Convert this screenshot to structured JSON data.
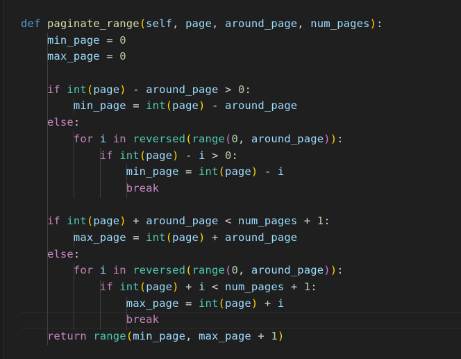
{
  "editor": {
    "theme": {
      "background": "#1f1f1f",
      "keyword": "#569cd6",
      "control": "#c586c0",
      "function": "#dcdcaa",
      "class": "#4ec9b0",
      "variable": "#9cdcfe",
      "number": "#b5cea8",
      "operator": "#d4d4d4",
      "bracket1": "#ffd700",
      "bracket2": "#da70d6",
      "bracket3": "#179fff"
    },
    "lines": [
      [
        [
          "kw",
          "def"
        ],
        [
          "op",
          " "
        ],
        [
          "fn",
          "paginate_range"
        ],
        [
          "b1",
          "("
        ],
        [
          "var",
          "self"
        ],
        [
          "op",
          ", "
        ],
        [
          "var",
          "page"
        ],
        [
          "op",
          ", "
        ],
        [
          "var",
          "around_page"
        ],
        [
          "op",
          ", "
        ],
        [
          "var",
          "num_pages"
        ],
        [
          "b1",
          ")"
        ],
        [
          "op",
          ":"
        ]
      ],
      [
        [
          "op",
          "    "
        ],
        [
          "var",
          "min_page"
        ],
        [
          "op",
          " = "
        ],
        [
          "num",
          "0"
        ]
      ],
      [
        [
          "op",
          "    "
        ],
        [
          "var",
          "max_page"
        ],
        [
          "op",
          " = "
        ],
        [
          "num",
          "0"
        ]
      ],
      [],
      [
        [
          "op",
          "    "
        ],
        [
          "ctrl",
          "if"
        ],
        [
          "op",
          " "
        ],
        [
          "cls",
          "int"
        ],
        [
          "b1",
          "("
        ],
        [
          "var",
          "page"
        ],
        [
          "b1",
          ")"
        ],
        [
          "op",
          " - "
        ],
        [
          "var",
          "around_page"
        ],
        [
          "op",
          " > "
        ],
        [
          "num",
          "0"
        ],
        [
          "op",
          ":"
        ]
      ],
      [
        [
          "op",
          "        "
        ],
        [
          "var",
          "min_page"
        ],
        [
          "op",
          " = "
        ],
        [
          "cls",
          "int"
        ],
        [
          "b1",
          "("
        ],
        [
          "var",
          "page"
        ],
        [
          "b1",
          ")"
        ],
        [
          "op",
          " - "
        ],
        [
          "var",
          "around_page"
        ]
      ],
      [
        [
          "op",
          "    "
        ],
        [
          "ctrl",
          "else"
        ],
        [
          "op",
          ":"
        ]
      ],
      [
        [
          "op",
          "        "
        ],
        [
          "ctrl",
          "for"
        ],
        [
          "op",
          " "
        ],
        [
          "var",
          "i"
        ],
        [
          "op",
          " "
        ],
        [
          "ctrl",
          "in"
        ],
        [
          "op",
          " "
        ],
        [
          "cls",
          "reversed"
        ],
        [
          "b1",
          "("
        ],
        [
          "cls",
          "range"
        ],
        [
          "b2",
          "("
        ],
        [
          "num",
          "0"
        ],
        [
          "op",
          ", "
        ],
        [
          "var",
          "around_page"
        ],
        [
          "b2",
          ")"
        ],
        [
          "b1",
          ")"
        ],
        [
          "op",
          ":"
        ]
      ],
      [
        [
          "op",
          "            "
        ],
        [
          "ctrl",
          "if"
        ],
        [
          "op",
          " "
        ],
        [
          "cls",
          "int"
        ],
        [
          "b1",
          "("
        ],
        [
          "var",
          "page"
        ],
        [
          "b1",
          ")"
        ],
        [
          "op",
          " - "
        ],
        [
          "var",
          "i"
        ],
        [
          "op",
          " > "
        ],
        [
          "num",
          "0"
        ],
        [
          "op",
          ":"
        ]
      ],
      [
        [
          "op",
          "                "
        ],
        [
          "var",
          "min_page"
        ],
        [
          "op",
          " = "
        ],
        [
          "cls",
          "int"
        ],
        [
          "b1",
          "("
        ],
        [
          "var",
          "page"
        ],
        [
          "b1",
          ")"
        ],
        [
          "op",
          " - "
        ],
        [
          "var",
          "i"
        ]
      ],
      [
        [
          "op",
          "                "
        ],
        [
          "ctrl",
          "break"
        ]
      ],
      [],
      [
        [
          "op",
          "    "
        ],
        [
          "ctrl",
          "if"
        ],
        [
          "op",
          " "
        ],
        [
          "cls",
          "int"
        ],
        [
          "b1",
          "("
        ],
        [
          "var",
          "page"
        ],
        [
          "b1",
          ")"
        ],
        [
          "op",
          " + "
        ],
        [
          "var",
          "around_page"
        ],
        [
          "op",
          " < "
        ],
        [
          "var",
          "num_pages"
        ],
        [
          "op",
          " + "
        ],
        [
          "num",
          "1"
        ],
        [
          "op",
          ":"
        ]
      ],
      [
        [
          "op",
          "        "
        ],
        [
          "var",
          "max_page"
        ],
        [
          "op",
          " = "
        ],
        [
          "cls",
          "int"
        ],
        [
          "b1",
          "("
        ],
        [
          "var",
          "page"
        ],
        [
          "b1",
          ")"
        ],
        [
          "op",
          " + "
        ],
        [
          "var",
          "around_page"
        ]
      ],
      [
        [
          "op",
          "    "
        ],
        [
          "ctrl",
          "else"
        ],
        [
          "op",
          ":"
        ]
      ],
      [
        [
          "op",
          "        "
        ],
        [
          "ctrl",
          "for"
        ],
        [
          "op",
          " "
        ],
        [
          "var",
          "i"
        ],
        [
          "op",
          " "
        ],
        [
          "ctrl",
          "in"
        ],
        [
          "op",
          " "
        ],
        [
          "cls",
          "reversed"
        ],
        [
          "b1",
          "("
        ],
        [
          "cls",
          "range"
        ],
        [
          "b2",
          "("
        ],
        [
          "num",
          "0"
        ],
        [
          "op",
          ", "
        ],
        [
          "var",
          "around_page"
        ],
        [
          "b2",
          ")"
        ],
        [
          "b1",
          ")"
        ],
        [
          "op",
          ":"
        ]
      ],
      [
        [
          "op",
          "            "
        ],
        [
          "ctrl",
          "if"
        ],
        [
          "op",
          " "
        ],
        [
          "cls",
          "int"
        ],
        [
          "b1",
          "("
        ],
        [
          "var",
          "page"
        ],
        [
          "b1",
          ")"
        ],
        [
          "op",
          " + "
        ],
        [
          "var",
          "i"
        ],
        [
          "op",
          " < "
        ],
        [
          "var",
          "num_pages"
        ],
        [
          "op",
          " + "
        ],
        [
          "num",
          "1"
        ],
        [
          "op",
          ":"
        ]
      ],
      [
        [
          "op",
          "                "
        ],
        [
          "var",
          "max_page"
        ],
        [
          "op",
          " = "
        ],
        [
          "cls",
          "int"
        ],
        [
          "b1",
          "("
        ],
        [
          "var",
          "page"
        ],
        [
          "b1",
          ")"
        ],
        [
          "op",
          " + "
        ],
        [
          "var",
          "i"
        ]
      ],
      [
        [
          "op",
          "                "
        ],
        [
          "ctrl",
          "break"
        ]
      ],
      [
        [
          "op",
          "    "
        ],
        [
          "ctrl",
          "return"
        ],
        [
          "op",
          " "
        ],
        [
          "cls",
          "range"
        ],
        [
          "b1",
          "("
        ],
        [
          "var",
          "min_page"
        ],
        [
          "op",
          ", "
        ],
        [
          "var",
          "max_page"
        ],
        [
          "op",
          " + "
        ],
        [
          "num",
          "1"
        ],
        [
          "b1",
          ")"
        ]
      ]
    ]
  }
}
